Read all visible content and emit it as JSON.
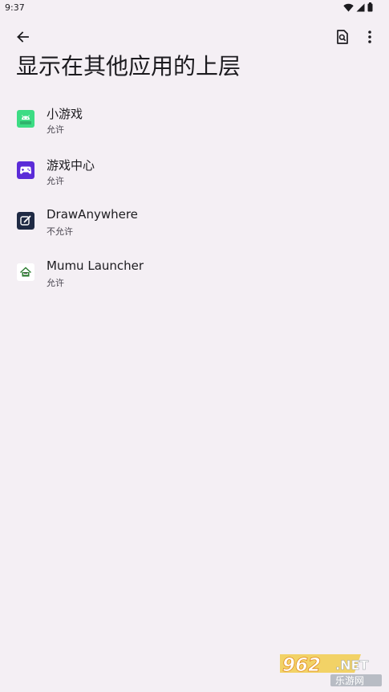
{
  "status_bar": {
    "time": "9:37"
  },
  "toolbar": {
    "back_icon": "arrow-back-icon",
    "search_icon": "search-in-page-icon",
    "more_icon": "more-vert-icon"
  },
  "page": {
    "title": "显示在其他应用的上层"
  },
  "apps": [
    {
      "name": "小游戏",
      "status": "允许",
      "icon": "android-icon",
      "icon_color": "#3ddc84"
    },
    {
      "name": "游戏中心",
      "status": "允许",
      "icon": "gamepad-icon",
      "icon_color": "#5b2bd8"
    },
    {
      "name": "DrawAnywhere",
      "status": "不允许",
      "icon": "draw-icon",
      "icon_color": "#1f2a44"
    },
    {
      "name": "Mumu Launcher",
      "status": "允许",
      "icon": "home-icon",
      "icon_color": "#2e7d32"
    }
  ],
  "watermark": {
    "number": "962",
    "net": ".NET",
    "caption": "乐游网"
  },
  "colors": {
    "background": "#f4eff4",
    "text_primary": "#1c1b1f",
    "text_secondary": "#49454f"
  }
}
